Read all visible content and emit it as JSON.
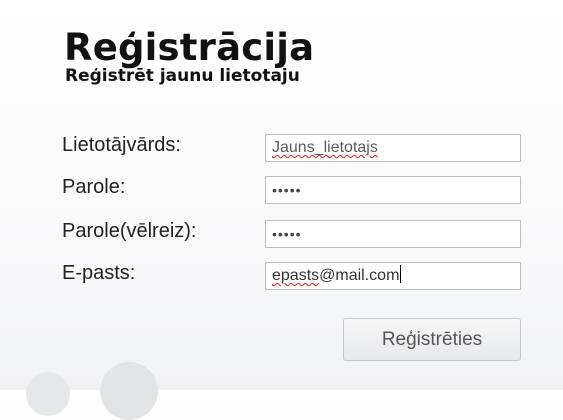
{
  "page": {
    "title": "Reģistrācija",
    "subtitle": "Reģistrēt jaunu lietotaju"
  },
  "form": {
    "username": {
      "label": "Lietotājvārds:",
      "value": "Jauns_lietotajs"
    },
    "password": {
      "label": "Parole:",
      "value": "•••••"
    },
    "password_repeat": {
      "label": "Parole(vēlreiz):",
      "value": "•••••"
    },
    "email": {
      "label": "E-pasts:",
      "value_misspelled": "epasts",
      "value_rest": "@mail.com"
    },
    "submit_label": "Reģistrēties"
  }
}
